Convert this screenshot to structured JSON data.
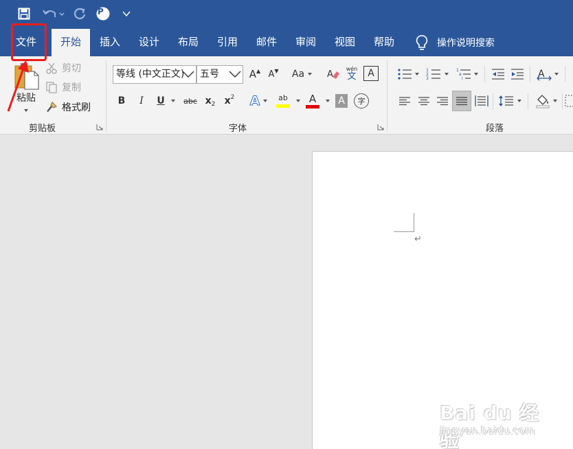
{
  "menu_tabs": [
    {
      "label": "文件",
      "active": false
    },
    {
      "label": "开始",
      "active": true
    },
    {
      "label": "插入",
      "active": false
    },
    {
      "label": "设计",
      "active": false
    },
    {
      "label": "布局",
      "active": false
    },
    {
      "label": "引用",
      "active": false
    },
    {
      "label": "邮件",
      "active": false
    },
    {
      "label": "审阅",
      "active": false
    },
    {
      "label": "视图",
      "active": false
    },
    {
      "label": "帮助",
      "active": false
    }
  ],
  "tell_me": {
    "label": "操作说明搜索",
    "icon": "lightbulb-icon"
  },
  "quick_access": {
    "save_icon": "save-icon",
    "undo_icon": "undo-icon",
    "redo_icon": "redo-icon",
    "avatar_letter": "P",
    "customize_icon": "chevron-down-icon"
  },
  "clipboard": {
    "paste_label": "粘贴",
    "cut_label": "剪切",
    "copy_label": "复制",
    "format_painter_label": "格式刷",
    "group_label": "剪贴板"
  },
  "font": {
    "font_name": "等线 (中文正文)",
    "font_size": "五号",
    "grow_label": "A",
    "shrink_label": "A",
    "change_case_label": "Aa",
    "phonetic_top": "wén",
    "phonetic_bottom": "文",
    "char_border_label": "A",
    "bold_label": "B",
    "italic_label": "I",
    "underline_label": "U",
    "strike_label": "abc",
    "subscript_label": "x",
    "subscript_sub": "2",
    "superscript_label": "x",
    "superscript_sup": "2",
    "effect_label": "A",
    "highlight_label": "ab",
    "font_color_label": "A",
    "shading_label": "A",
    "enclose_label": "字",
    "group_label": "字体"
  },
  "paragraph": {
    "group_label": "段落"
  },
  "document": {
    "paragraph_mark": "↵"
  },
  "watermark": {
    "logo": "Bai du 经验",
    "sub": "jingyan.baidu.com"
  },
  "colors": {
    "brand": "#2b579a",
    "ribbon": "#f3f3f3",
    "annotation": "#ef1c1c",
    "highlight": "#ffff00",
    "font_color": "#e00000"
  }
}
